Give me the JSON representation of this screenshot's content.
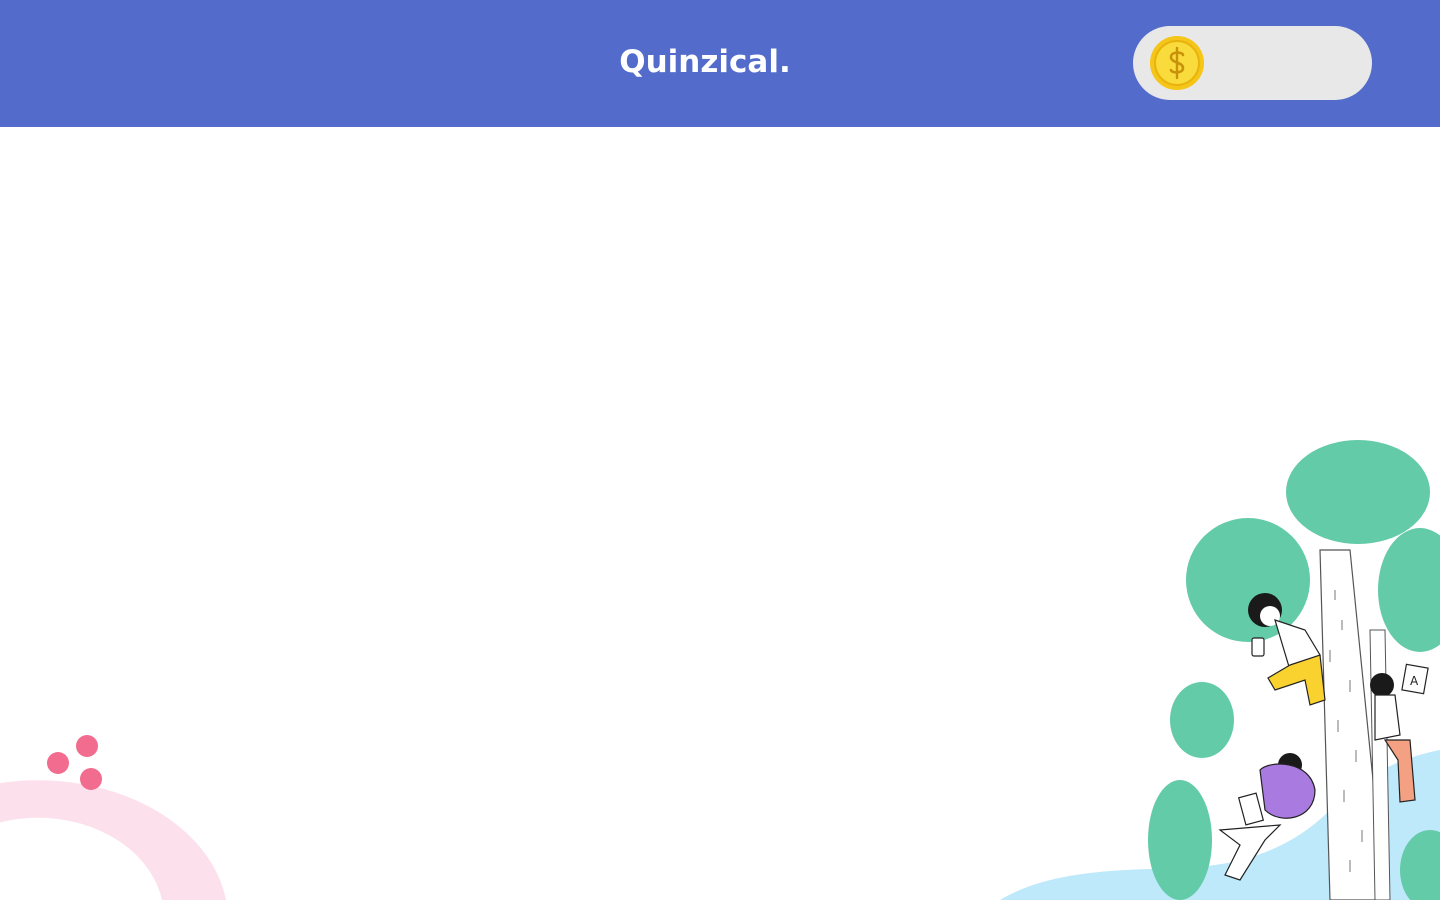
{
  "header": {
    "logo_text": "Quinzical.",
    "background_color": "#536CCB",
    "coin_widget": {
      "icon": "dollar-coin-icon",
      "balance": ""
    }
  },
  "main": {
    "content_text": ""
  },
  "decorations": {
    "left": "pink-arc-dots",
    "right": "people-in-trees-illustration",
    "accent_pink": "#F26C8F",
    "accent_pink_light": "#FCE1EC",
    "accent_green": "#63CBA8",
    "accent_blue": "#BDE9FB",
    "accent_yellow": "#F9D230",
    "accent_purple": "#A97AE0"
  }
}
